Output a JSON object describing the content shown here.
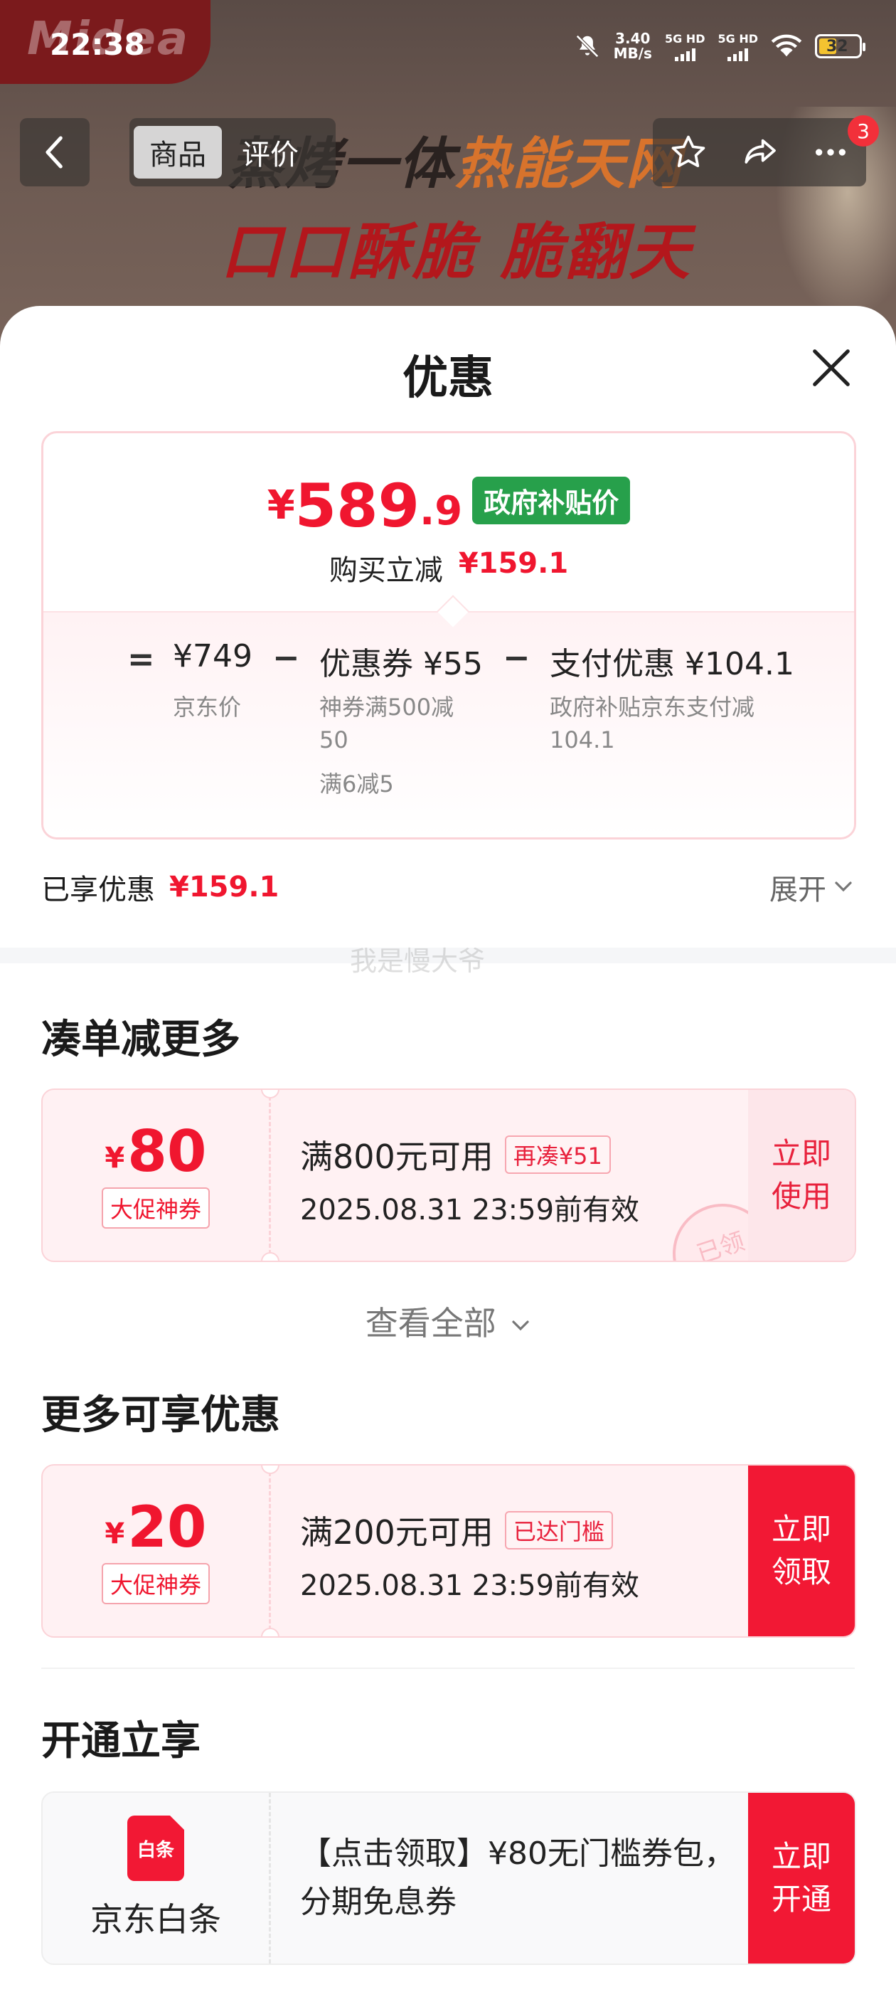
{
  "status_bar": {
    "time": "22:38",
    "net_speed": "3.40",
    "net_unit": "MB/s",
    "sig1": "5G HD",
    "sig2": "5G HD",
    "battery": "32"
  },
  "background": {
    "logo": "Midea",
    "banner_line1_a": "蒸烤一体",
    "banner_line1_b": "热能天网",
    "banner_line2": "口口酥脆 脆翻天"
  },
  "nav": {
    "tabs": [
      "商品",
      "评价"
    ],
    "badge": "3"
  },
  "sheet": {
    "title": "优惠",
    "summary": {
      "currency": "¥",
      "price_int": "589",
      "price_dec": ".9",
      "price_tag": "政府补贴价",
      "instant_label": "购买立减",
      "instant_amount": "¥159.1",
      "equals": "=",
      "minus": "−",
      "jd_price": "¥749",
      "jd_price_label": "京东价",
      "coupon_label": "优惠券 ¥55",
      "coupon_sub1": "神券满500减",
      "coupon_sub1b": "50",
      "coupon_sub2": "满6减5",
      "pay_label": "支付优惠 ¥104.1",
      "pay_sub1": "政府补贴京东支付减",
      "pay_sub1b": "104.1"
    },
    "enjoyed_label": "已享优惠",
    "enjoyed_amount": "¥159.1",
    "expand_label": "展开",
    "watermark": "我是慢大爷",
    "section_more": "凑单减更多",
    "coupon1": {
      "currency": "¥",
      "amount": "80",
      "kind": "大促神券",
      "condition": "满800元可用",
      "tag": "再凑¥51",
      "validity": "2025.08.31 23:59前有效",
      "action_l1": "立即",
      "action_l2": "使用",
      "stamp": "已领"
    },
    "view_all": "查看全部",
    "section_extra": "更多可享优惠",
    "coupon2": {
      "currency": "¥",
      "amount": "20",
      "kind": "大促神券",
      "condition": "满200元可用",
      "tag": "已达门槛",
      "validity": "2025.08.31 23:59前有效",
      "action_l1": "立即",
      "action_l2": "领取"
    },
    "section_open": "开通立享",
    "baitiao": {
      "logo_text": "白条",
      "name": "京东白条",
      "desc_l1": "【点击领取】¥80无门槛券包，",
      "desc_l2": "分期免息券",
      "action_l1": "立即",
      "action_l2": "开通"
    }
  },
  "colors": {
    "accent_red": "#f0162f",
    "gov_green": "#27a04b",
    "coupon_bg": "#fff1f3"
  }
}
